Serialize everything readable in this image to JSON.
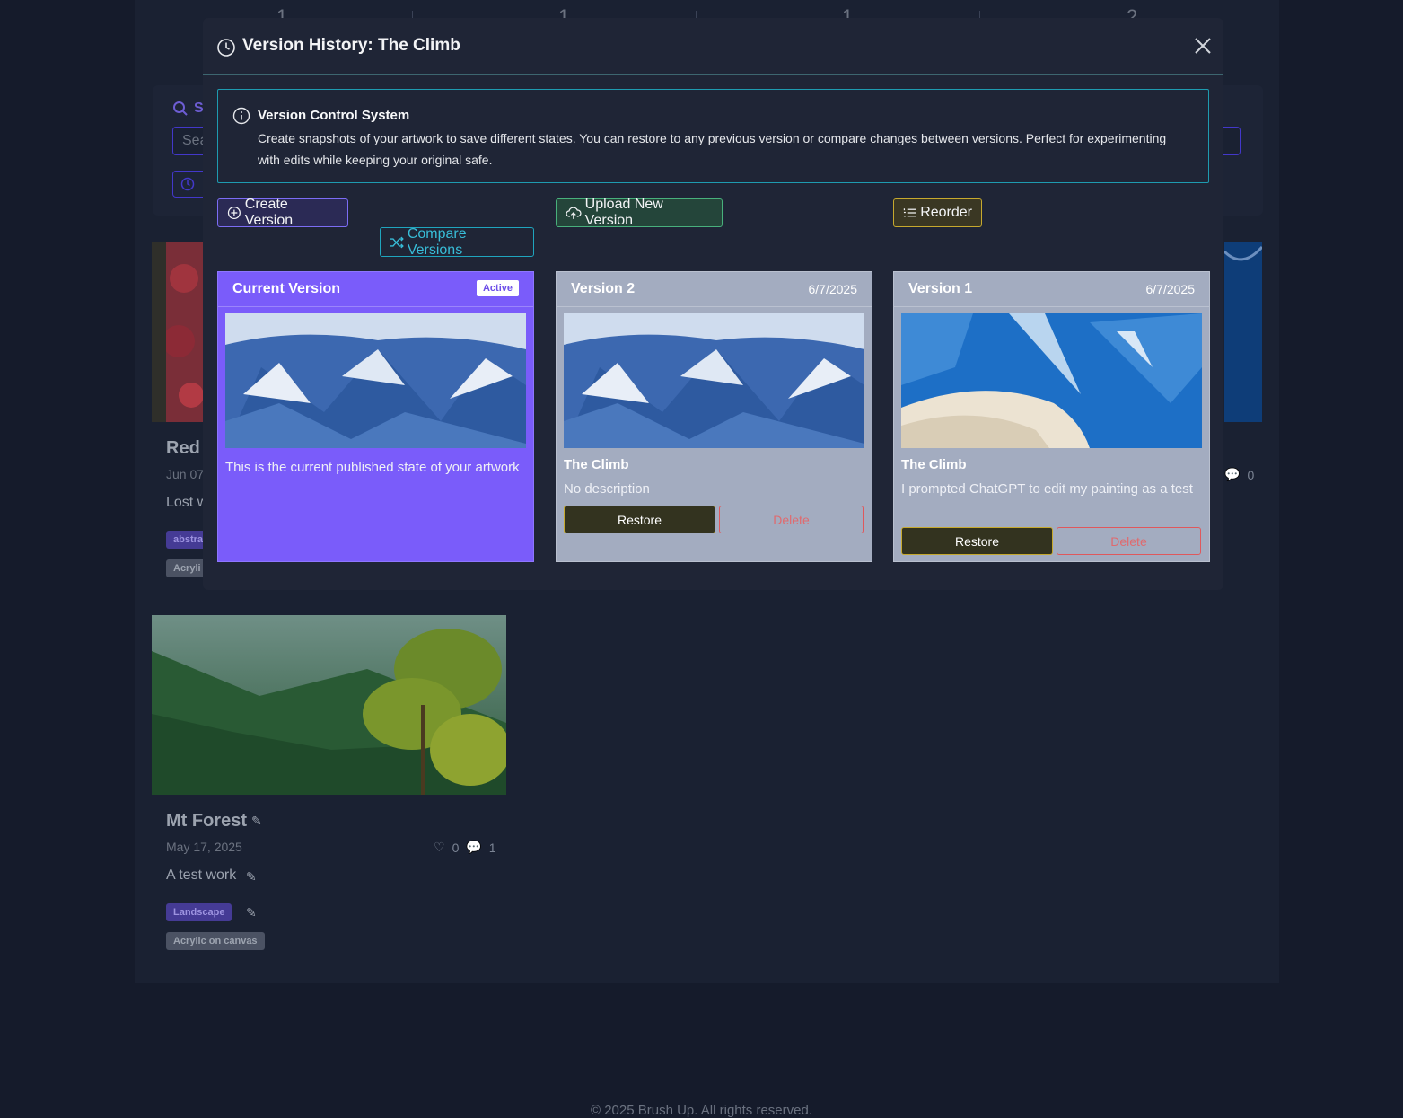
{
  "background": {
    "stats": [
      "1",
      "1",
      "1",
      "2"
    ],
    "search_label": "S",
    "search_placeholder": "Sea",
    "artworks": [
      {
        "title": "Red",
        "date": "Jun 07",
        "desc": "Lost w",
        "tags": [
          "abstra"
        ],
        "medium": "Acryli",
        "comments": "0"
      },
      {
        "title": "Mt Forest",
        "date": "May 17, 2025",
        "desc": "A test work",
        "tags": [
          "Landscape"
        ],
        "medium": "Acrylic on canvas",
        "likes": "0",
        "comments": "1"
      }
    ],
    "footer": "© 2025 Brush Up. All rights reserved."
  },
  "modal": {
    "title": "Version History: The Climb",
    "info": {
      "title": "Version Control System",
      "text": "Create snapshots of your artwork to save different states. You can restore to any previous version or compare changes between versions. Perfect for experimenting with edits while keeping your original safe."
    },
    "buttons": {
      "create": "Create Version",
      "compare": "Compare Versions",
      "upload": "Upload New Version",
      "reorder": "Reorder"
    },
    "versions": [
      {
        "label": "Current Version",
        "badge": "Active",
        "desc": "This is the current published state of your artwork"
      },
      {
        "label": "Version 2",
        "date": "6/7/2025",
        "name": "The Climb",
        "desc": "No description",
        "restore": "Restore",
        "delete": "Delete"
      },
      {
        "label": "Version 1",
        "date": "6/7/2025",
        "name": "The Climb",
        "desc": "I prompted ChatGPT to edit my painting as a test",
        "restore": "Restore",
        "delete": "Delete"
      }
    ]
  },
  "colors": {
    "current_version": "#7a5cfa",
    "old_version": "#a3acc0",
    "info_border": "#1e9bb0",
    "restore_border": "#c6a92e",
    "delete": "#ef4444"
  }
}
